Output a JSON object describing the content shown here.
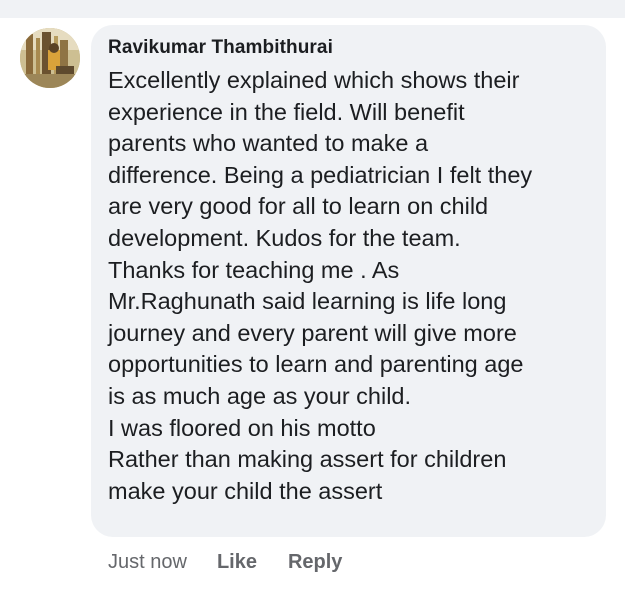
{
  "comment": {
    "author": "Ravikumar Thambithurai",
    "lines": [
      "Excellently explained which shows their",
      "experience in the field.  Will benefit",
      "parents who wanted  to make a",
      "difference. Being a pediatrician I felt they",
      "are very good for all to learn on child",
      "development.  Kudos for the team.",
      "Thanks for teaching me . As",
      "Mr.Raghunath said learning is life long",
      "journey and every parent will give more",
      "opportunities to learn and parenting age",
      "is as much age as your child.",
      "I was floored on his motto",
      "Rather than making assert for children",
      "make your child the assert"
    ]
  },
  "actions": {
    "timestamp": "Just now",
    "like_label": "Like",
    "reply_label": "Reply"
  },
  "colors": {
    "bubble_background": "#f0f2f5",
    "text_primary": "#1c1e21",
    "text_secondary": "#65676b"
  }
}
